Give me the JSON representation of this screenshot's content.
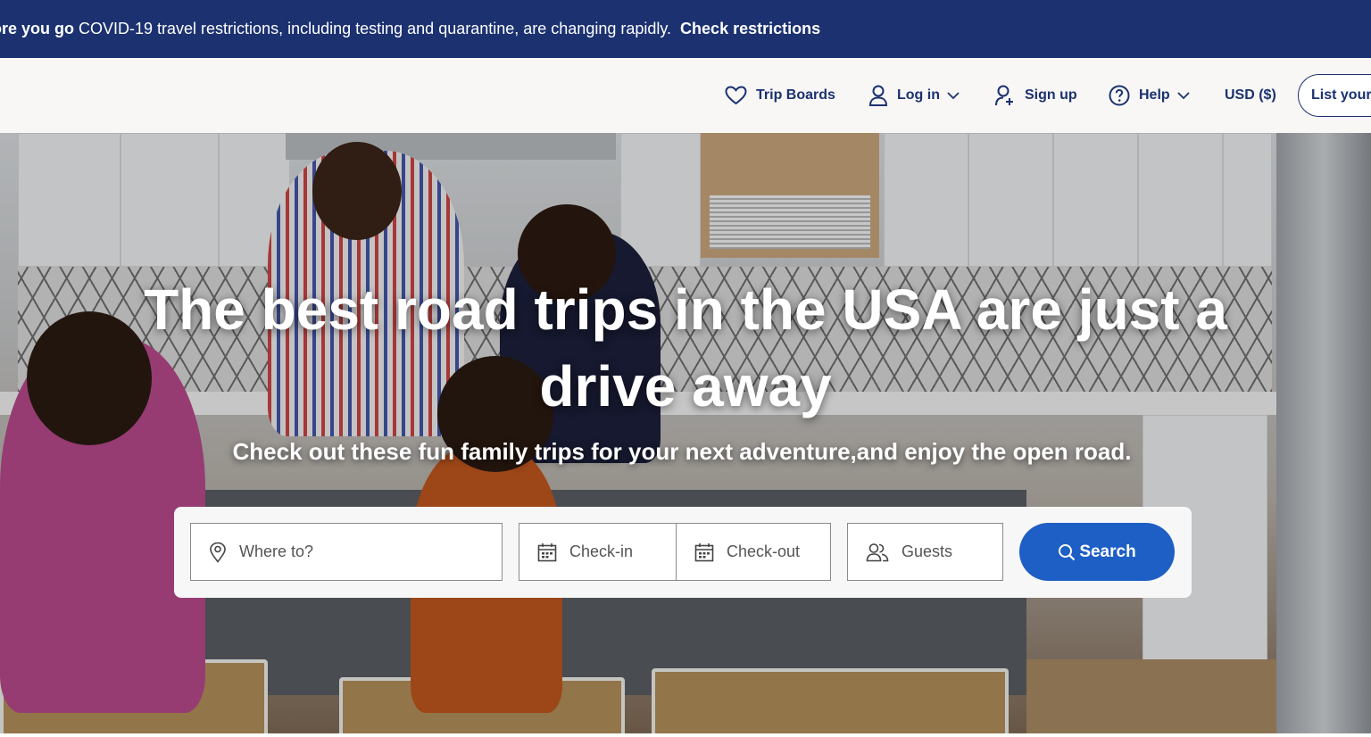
{
  "banner": {
    "lead": "ore you go",
    "message": "COVID-19 travel restrictions, including testing and quarantine, are changing rapidly.",
    "link": "Check restrictions"
  },
  "nav": {
    "trip_boards": "Trip Boards",
    "log_in": "Log in",
    "sign_up": "Sign up",
    "help": "Help",
    "currency": "USD ($)",
    "list_property": "List your"
  },
  "hero": {
    "title": "The best road trips in the USA are just a drive away",
    "subtitle": "Check out these fun family trips for your next adventure,and enjoy the open road."
  },
  "search": {
    "destination_placeholder": "Where to?",
    "checkin_placeholder": "Check-in",
    "checkout_placeholder": "Check-out",
    "guests_placeholder": "Guests",
    "button_label": "Search"
  },
  "colors": {
    "brand_navy": "#1b3170",
    "search_blue": "#1d5fc4"
  },
  "icons": [
    "heart-icon",
    "user-icon",
    "chevron-down-icon",
    "add-user-icon",
    "help-circle-icon",
    "location-pin-icon",
    "calendar-icon",
    "guests-icon",
    "search-icon"
  ]
}
